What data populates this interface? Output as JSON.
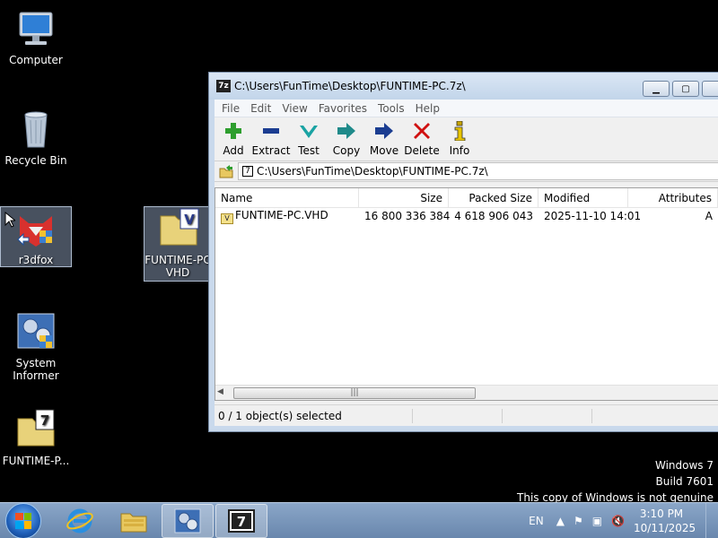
{
  "desktop": {
    "icons": [
      {
        "label": "Computer"
      },
      {
        "label": "Recycle Bin"
      },
      {
        "label": "r3dfox"
      },
      {
        "label": "FUNTIME-PC VHD"
      },
      {
        "label": "System Informer"
      },
      {
        "label": "FUNTIME-P..."
      }
    ]
  },
  "window": {
    "title": "C:\\Users\\FunTime\\Desktop\\FUNTIME-PC.7z\\",
    "app_icon": "7z",
    "menu": [
      "File",
      "Edit",
      "View",
      "Favorites",
      "Tools",
      "Help"
    ],
    "toolbar": [
      {
        "label": "Add",
        "icon": "plus-icon",
        "color": "#2e9e2e"
      },
      {
        "label": "Extract",
        "icon": "minus-icon",
        "color": "#1b3d91"
      },
      {
        "label": "Test",
        "icon": "check-icon",
        "color": "#1aa3a3"
      },
      {
        "label": "Copy",
        "icon": "arrow-icon",
        "color": "#1f8a8a"
      },
      {
        "label": "Move",
        "icon": "arrow-icon",
        "color": "#1b3d91"
      },
      {
        "label": "Delete",
        "icon": "x-icon",
        "color": "#d01010"
      },
      {
        "label": "Info",
        "icon": "info-icon",
        "color": "#c8a400"
      }
    ],
    "address": "C:\\Users\\FunTime\\Desktop\\FUNTIME-PC.7z\\",
    "columns": {
      "name": "Name",
      "size": "Size",
      "packed": "Packed Size",
      "modified": "Modified",
      "attributes": "Attributes"
    },
    "rows": [
      {
        "name": "FUNTIME-PC.VHD",
        "size": "16 800 336 384",
        "packed": "4 618 906 043",
        "modified": "2025-11-10 14:01",
        "attributes": "A"
      }
    ],
    "status": "0 / 1 object(s) selected"
  },
  "watermark": {
    "line1": "Windows 7",
    "line2": "Build 7601",
    "line3": "This copy of Windows is not genuine"
  },
  "taskbar": {
    "lang": "EN",
    "time": "3:10 PM",
    "date": "10/11/2025"
  }
}
